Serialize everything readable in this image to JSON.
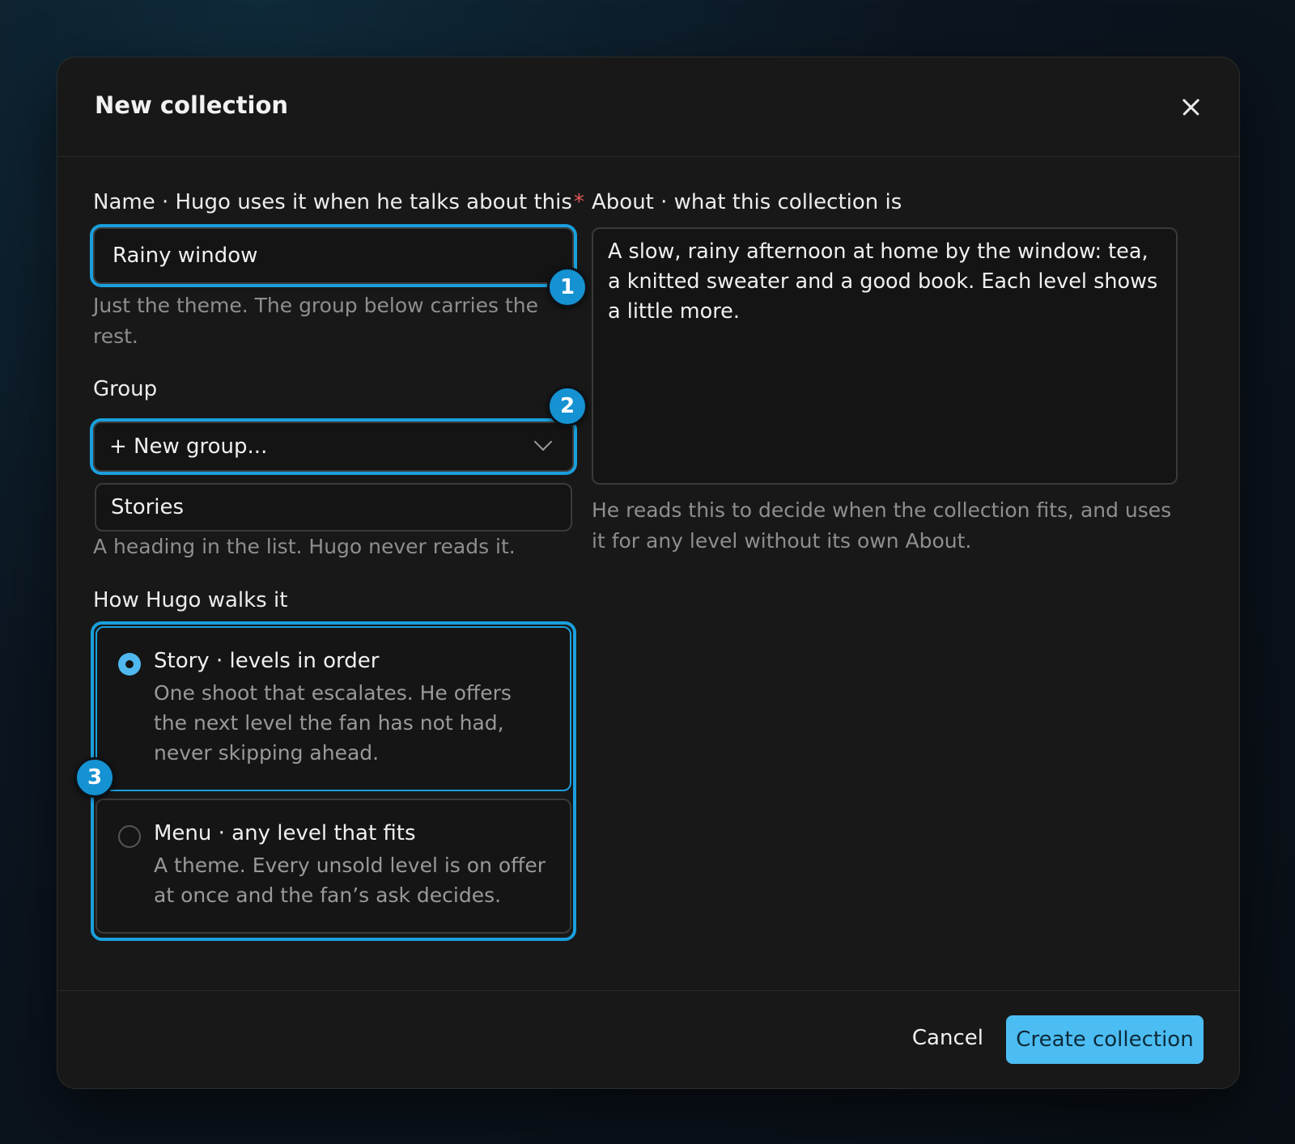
{
  "dialog": {
    "title": "New collection",
    "close_icon": "close-icon"
  },
  "name_field": {
    "label": "Name · Hugo uses it when he talks about this",
    "required_mark": "*",
    "value": "Rainy window",
    "hint": "Just the theme. The group below carries the rest.",
    "badge": "1"
  },
  "group_field": {
    "label": "Group",
    "selected": "+ New group...",
    "new_group_value": "Stories",
    "hint": "A heading in the list. Hugo never reads it.",
    "badge": "2",
    "chevron_icon": "chevron-down-icon"
  },
  "walk_mode": {
    "label": "How Hugo walks it",
    "badge": "3",
    "options": [
      {
        "title": "Story · levels in order",
        "description": "One shoot that escalates. He offers the next level the fan has not had, never skipping ahead.",
        "selected": true
      },
      {
        "title": "Menu · any level that fits",
        "description": "A theme. Every unsold level is on offer at once and the fan’s ask decides.",
        "selected": false
      }
    ]
  },
  "about_field": {
    "label": "About · what this collection is",
    "value": "A slow, rainy afternoon at home by the window: tea, a knitted sweater and a good book. Each level shows a little more.",
    "hint": "He reads this to decide when the collection fits, and uses it for any level without its own About."
  },
  "footer": {
    "cancel_label": "Cancel",
    "create_label": "Create collection"
  },
  "colors": {
    "accent": "#1a9fdc",
    "primary_button": "#4cbdf2",
    "required": "#e05a55",
    "background": "#181818"
  }
}
